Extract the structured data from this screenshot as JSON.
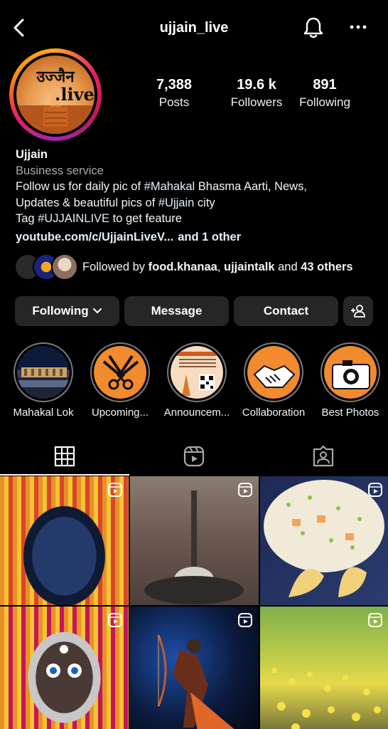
{
  "header": {
    "username": "ujjain_live",
    "back_icon": "chevron-left-icon",
    "bell_icon": "bell-icon",
    "more_icon": "more-horizontal-icon"
  },
  "avatar": {
    "text_top": "उज्जैन",
    "text_bottom": ".live"
  },
  "stats": [
    {
      "value": "7,388",
      "label": "Posts"
    },
    {
      "value": "19.6 k",
      "label": "Followers"
    },
    {
      "value": "891",
      "label": "Following"
    }
  ],
  "bio": {
    "name": "Ujjain",
    "category": "Business service",
    "line1_pre": "Follow us for daily pic of ",
    "line1_tag": "#Mahakal",
    "line1_post": " Bhasma Aarti, News,",
    "line2_pre": "Updates & beautiful pics of ",
    "line2_tag": "#Ujjain",
    "line2_post": " city",
    "line3_pre": "Tag ",
    "line3_tag": "#UJJAINLIVE",
    "line3_post": " to get feature",
    "link": "youtube.com/c/UjjainLiveV...",
    "link_more": "and 1 other"
  },
  "followed_by": {
    "prefix": "Followed by ",
    "user1": "food.khanaa",
    "sep": ", ",
    "user2": "ujjaintalk",
    "mid": " and ",
    "others": "43 others"
  },
  "buttons": {
    "following": "Following",
    "message": "Message",
    "contact": "Contact",
    "add_user_icon": "add-user-icon"
  },
  "highlights": [
    {
      "label": "Mahakal Lok"
    },
    {
      "label": "Upcoming..."
    },
    {
      "label": "Announcem..."
    },
    {
      "label": "Collaboration"
    },
    {
      "label": "Best Photos"
    }
  ],
  "tabs": [
    {
      "name": "grid",
      "icon": "grid-icon"
    },
    {
      "name": "reels",
      "icon": "reels-icon"
    },
    {
      "name": "tagged",
      "icon": "tagged-icon"
    }
  ],
  "colors": {
    "background": "#000000",
    "button": "#262626",
    "link": "#e0f1ff",
    "secondary": "#a8a8a8"
  }
}
